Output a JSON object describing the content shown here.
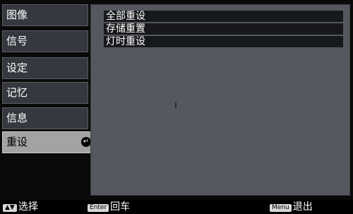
{
  "menu": {
    "items": [
      {
        "label": "图像"
      },
      {
        "label": "信号"
      },
      {
        "label": "设定"
      },
      {
        "label": "记忆"
      },
      {
        "label": "信息"
      },
      {
        "label": "重设",
        "selected": true,
        "icon": "enter-icon"
      }
    ],
    "enter_glyph": "↵"
  },
  "panel": {
    "options": [
      {
        "label": "全部重设"
      },
      {
        "label": "存储重置"
      },
      {
        "label": "灯时重设"
      }
    ]
  },
  "footer": {
    "select_key": "▲▼",
    "select_label": "选择",
    "enter_key": "Enter",
    "enter_label": "回车",
    "menu_key": "Menu",
    "menu_label": "退出"
  },
  "colors": {
    "menu_item_bg": "#35383f",
    "menu_item_selected_bg": "#a3a3a3",
    "panel_bg": "#55585f",
    "option_bg": "#17181b"
  }
}
